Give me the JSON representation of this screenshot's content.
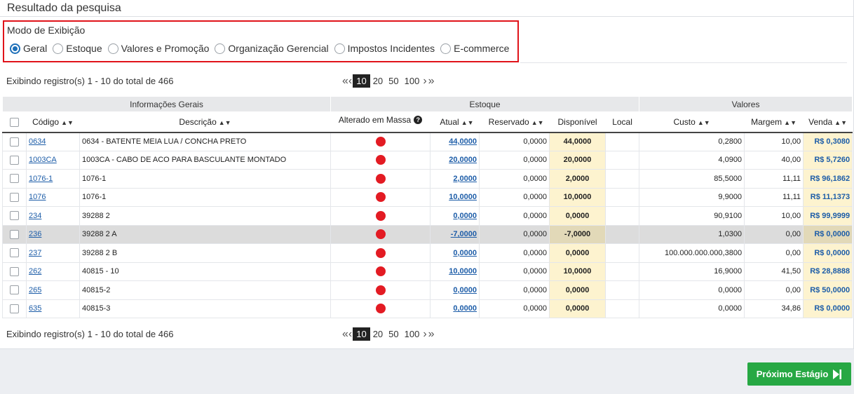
{
  "panel": {
    "title": "Resultado da pesquisa"
  },
  "mode": {
    "label": "Modo de Exibição",
    "options": [
      "Geral",
      "Estoque",
      "Valores e Promoção",
      "Organização Gerencial",
      "Impostos Incidentes",
      "E-commerce"
    ],
    "selected": "Geral"
  },
  "records": {
    "text_top": "Exibindo registro(s) 1 - 10 do total de 466",
    "text_bottom": "Exibindo registro(s) 1 - 10 do total de 466"
  },
  "pager": {
    "first": "«",
    "prev": "‹",
    "next": "›",
    "last": "»",
    "sizes": [
      "10",
      "20",
      "50",
      "100"
    ],
    "active": "10"
  },
  "table": {
    "groups": [
      "Informações Gerais",
      "Estoque",
      "Valores"
    ],
    "headers": {
      "codigo": "Código",
      "descricao": "Descrição",
      "alterado": "Alterado em Massa",
      "atual": "Atual",
      "reservado": "Reservado",
      "disponivel": "Disponível",
      "local": "Local",
      "custo": "Custo",
      "margem": "Margem",
      "venda": "Venda"
    },
    "rows": [
      {
        "codigo": "0634",
        "descricao": "0634 - BATENTE MEIA LUA / CONCHA PRETO",
        "atual": "44,0000",
        "reservado": "0,0000",
        "disponivel": "44,0000",
        "local": "",
        "custo": "0,2800",
        "margem": "10,00",
        "venda": "R$ 0,3080"
      },
      {
        "codigo": "1003CA",
        "descricao": "1003CA - CABO DE ACO PARA BASCULANTE MONTADO",
        "atual": "20,0000",
        "reservado": "0,0000",
        "disponivel": "20,0000",
        "local": "",
        "custo": "4,0900",
        "margem": "40,00",
        "venda": "R$ 5,7260"
      },
      {
        "codigo": "1076-1",
        "descricao": "1076-1",
        "atual": "2,0000",
        "reservado": "0,0000",
        "disponivel": "2,0000",
        "local": "",
        "custo": "85,5000",
        "margem": "11,11",
        "venda": "R$ 96,1862"
      },
      {
        "codigo": "1076",
        "descricao": "1076-1",
        "atual": "10,0000",
        "reservado": "0,0000",
        "disponivel": "10,0000",
        "local": "",
        "custo": "9,9000",
        "margem": "11,11",
        "venda": "R$ 11,1373"
      },
      {
        "codigo": "234",
        "descricao": "39288 2",
        "atual": "0,0000",
        "reservado": "0,0000",
        "disponivel": "0,0000",
        "local": "",
        "custo": "90,9100",
        "margem": "10,00",
        "venda": "R$ 99,9999"
      },
      {
        "codigo": "236",
        "descricao": "39288 2 A",
        "atual": "-7,0000",
        "reservado": "0,0000",
        "disponivel": "-7,0000",
        "local": "",
        "custo": "1,0300",
        "margem": "0,00",
        "venda": "R$ 0,0000"
      },
      {
        "codigo": "237",
        "descricao": "39288 2 B",
        "atual": "0,0000",
        "reservado": "0,0000",
        "disponivel": "0,0000",
        "local": "",
        "custo": "100.000.000.000,3800",
        "margem": "0,00",
        "venda": "R$ 0,0000"
      },
      {
        "codigo": "262",
        "descricao": "40815 - 10",
        "atual": "10,0000",
        "reservado": "0,0000",
        "disponivel": "10,0000",
        "local": "",
        "custo": "16,9000",
        "margem": "41,50",
        "venda": "R$ 28,8888"
      },
      {
        "codigo": "265",
        "descricao": "40815-2",
        "atual": "0,0000",
        "reservado": "0,0000",
        "disponivel": "0,0000",
        "local": "",
        "custo": "0,0000",
        "margem": "0,00",
        "venda": "R$ 50,0000"
      },
      {
        "codigo": "635",
        "descricao": "40815-3",
        "atual": "0,0000",
        "reservado": "0,0000",
        "disponivel": "0,0000",
        "local": "",
        "custo": "0,0000",
        "margem": "34,86",
        "venda": "R$ 0,0000"
      }
    ],
    "highlighted_row": "236",
    "status_color": "#e31b23"
  },
  "actions": {
    "next_stage": "Próximo Estágio"
  },
  "colors": {
    "accent": "#1d6fb8",
    "link": "#1d5da8",
    "highlight": "#fdf3cf",
    "next_button": "#27a844",
    "frame": "#e0131a"
  }
}
